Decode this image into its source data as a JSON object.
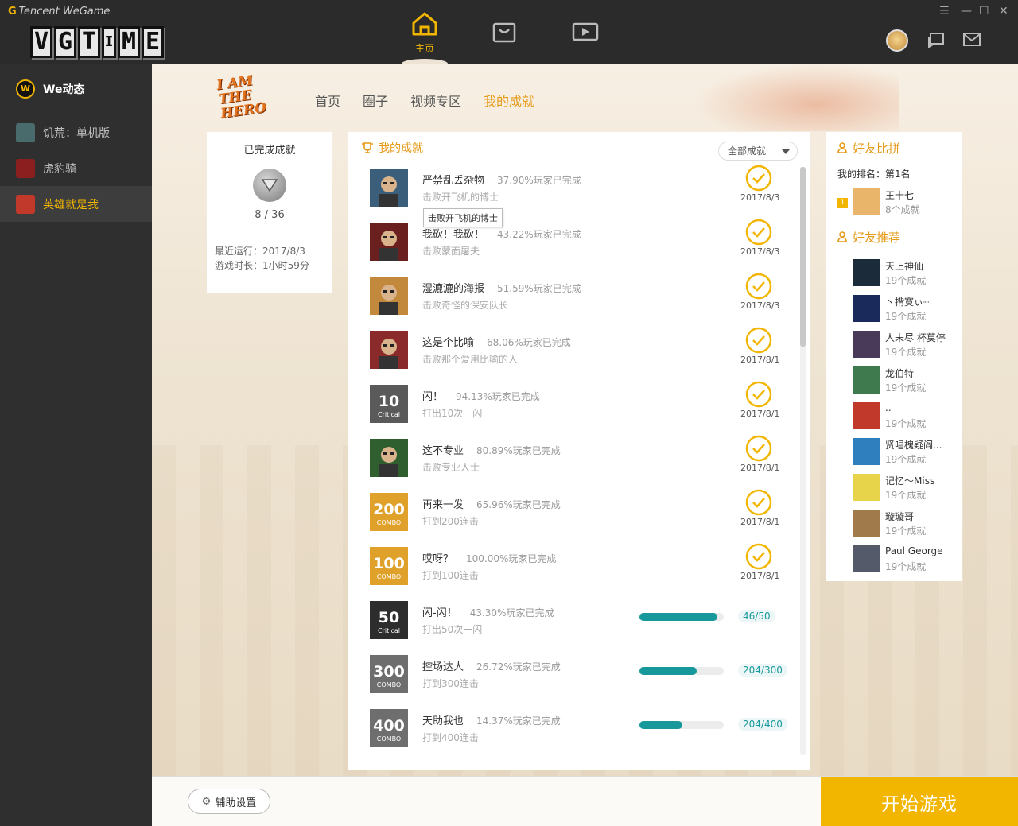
{
  "app": {
    "brand_prefix": "G",
    "brand_name": "Tencent WeGame",
    "watermark": [
      "V",
      "G",
      "T",
      "I",
      "M",
      "E"
    ],
    "nav_home_label": "主页",
    "window": {
      "menu": "☰",
      "minimize": "—",
      "maximize": "☐",
      "close": "✕"
    }
  },
  "sidebar": {
    "header": "We动态",
    "logo_letter": "W",
    "items": [
      {
        "label": "饥荒：单机版",
        "color": "#4a6b6b"
      },
      {
        "label": "虎豹骑",
        "color": "#8b1f1f"
      },
      {
        "label": "英雄就是我",
        "color": "#c0392b"
      }
    ]
  },
  "hero_logo": "I AM THE HERO",
  "tabs": [
    "首页",
    "圈子",
    "视频专区",
    "我的成就"
  ],
  "summary": {
    "title": "已完成成就",
    "count": "8 / 36",
    "last_run": "最近运行：2017/8/3",
    "play_time": "游戏时长：1小时59分"
  },
  "achievements": {
    "title": "我的成就",
    "filter": "全部成就",
    "tooltip": "击败开飞机的博士",
    "items": [
      {
        "name": "严禁乱丢杂物",
        "percent": "37.90%玩家已完成",
        "desc": "击败开飞机的博士",
        "date": "2017/8/3",
        "icon": "villain-doctor",
        "icon_color": "#3b5f7a"
      },
      {
        "name": "我砍！我砍！",
        "percent": "43.22%玩家已完成",
        "desc": "击败蒙面屠夫",
        "date": "2017/8/3",
        "icon": "masked-butcher",
        "icon_color": "#6b2020"
      },
      {
        "name": "湿漉漉的海报",
        "percent": "51.59%玩家已完成",
        "desc": "击败奇怪的保安队长",
        "date": "2017/8/3",
        "icon": "security-captain",
        "icon_color": "#c2883c"
      },
      {
        "name": "这是个比喻",
        "percent": "68.06%玩家已完成",
        "desc": "击败那个爱用比喻的人",
        "date": "2017/8/1",
        "icon": "metaphor-man",
        "icon_color": "#8b2a2a"
      },
      {
        "name": "闪！",
        "percent": "94.13%玩家已完成",
        "desc": "打出10次一闪",
        "date": "2017/8/1",
        "icon": "critical-10",
        "icon_color": "#5a5a5a",
        "badge_text": "10",
        "badge_sub": "Critical"
      },
      {
        "name": "这不专业",
        "percent": "80.89%玩家已完成",
        "desc": "击败专业人士",
        "date": "2017/8/1",
        "icon": "professional",
        "icon_color": "#2f5e2f"
      },
      {
        "name": "再来一发",
        "percent": "65.96%玩家已完成",
        "desc": "打到200连击",
        "date": "2017/8/1",
        "icon": "combo-200",
        "icon_color": "#e0a12a",
        "badge_text": "200",
        "badge_sub": "COMBO"
      },
      {
        "name": "哎呀？",
        "percent": "100.00%玩家已完成",
        "desc": "打到100连击",
        "date": "2017/8/1",
        "icon": "combo-100",
        "icon_color": "#e0a12a",
        "badge_text": "100",
        "badge_sub": "COMBO"
      },
      {
        "name": "闪-闪！",
        "percent": "43.30%玩家已完成",
        "desc": "打出50次一闪",
        "progress": "46/50",
        "progress_ratio": 0.92,
        "icon": "critical-50",
        "icon_color": "#2d2d2d",
        "badge_text": "50",
        "badge_sub": "Critical"
      },
      {
        "name": "控场达人",
        "percent": "26.72%玩家已完成",
        "desc": "打到300连击",
        "progress": "204/300",
        "progress_ratio": 0.68,
        "icon": "combo-300",
        "icon_color": "#6e6e6e",
        "badge_text": "300",
        "badge_sub": "COMBO"
      },
      {
        "name": "天助我也",
        "percent": "14.37%玩家已完成",
        "desc": "打到400连击",
        "progress": "204/400",
        "progress_ratio": 0.51,
        "icon": "combo-400",
        "icon_color": "#6e6e6e",
        "badge_text": "400",
        "badge_sub": "COMBO"
      }
    ]
  },
  "friends": {
    "compare_title": "好友比拼",
    "my_rank": "我的排名：第1名",
    "top": {
      "rank": "1",
      "name": "王十七",
      "count": "8个成就",
      "color": "#e8b56a"
    },
    "recommend_title": "好友推荐",
    "items": [
      {
        "name": "天上神仙",
        "count": "19个成就",
        "color": "#1c2b3a"
      },
      {
        "name": "丶揹寞ぃ┈",
        "count": "19个成就",
        "color": "#1a2a5a"
      },
      {
        "name": "人未尽 杯莫停",
        "count": "19个成就",
        "color": "#4a3a5a"
      },
      {
        "name": "龙伯特",
        "count": "19个成就",
        "color": "#3f7a4f"
      },
      {
        "name": "..",
        "count": "19个成就",
        "color": "#c0392b"
      },
      {
        "name": "贤唱槐疑阎...",
        "count": "19个成就",
        "color": "#2f7fbf"
      },
      {
        "name": "记忆～Miss",
        "count": "19个成就",
        "color": "#e8d44a"
      },
      {
        "name": "璇璇哥",
        "count": "19个成就",
        "color": "#a07a4a"
      },
      {
        "name": "Paul George",
        "count": "19个成就",
        "color": "#555a6a"
      }
    ]
  },
  "bottom": {
    "assist": "辅助设置",
    "start": "开始游戏"
  },
  "colors": {
    "accent": "#f2b600",
    "orange": "#e59a17",
    "teal": "#17999b"
  }
}
